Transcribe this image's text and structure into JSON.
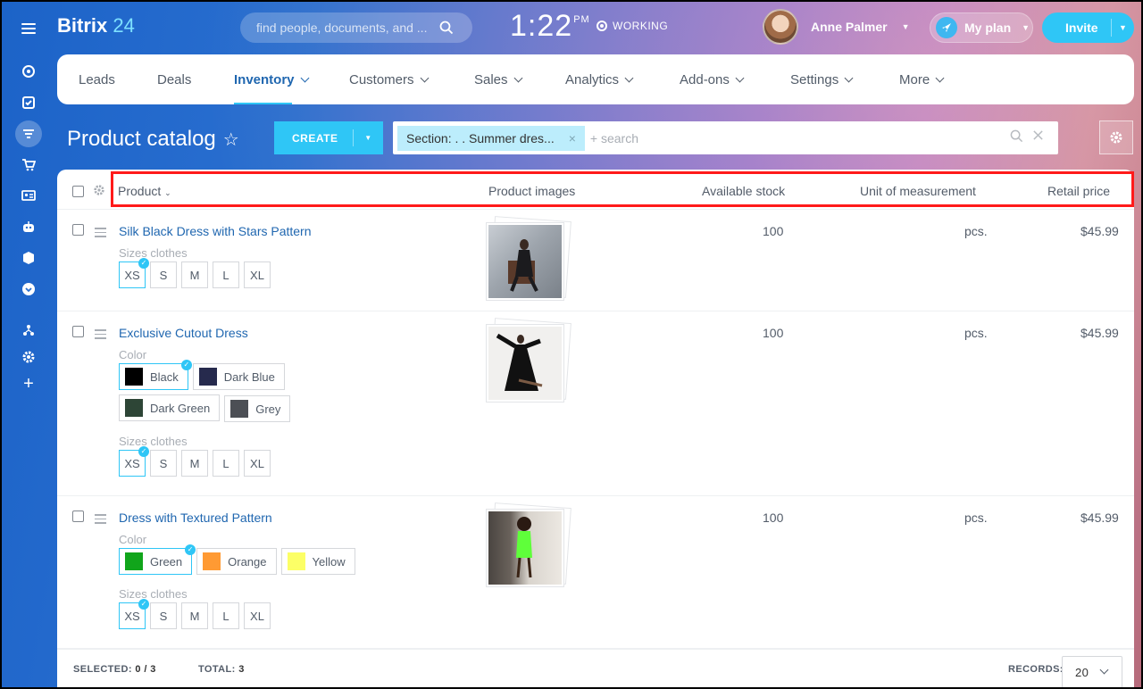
{
  "app": {
    "logo_main": "Bitrix",
    "logo_num": "24"
  },
  "search": {
    "placeholder": "find people, documents, and ..."
  },
  "clock": {
    "time": "1:22",
    "ampm": "PM",
    "status": "WORKING"
  },
  "user": {
    "name": "Anne Palmer"
  },
  "plan": {
    "label": "My plan"
  },
  "invite": {
    "label": "Invite"
  },
  "nav": {
    "items": [
      {
        "label": "Leads"
      },
      {
        "label": "Deals"
      },
      {
        "label": "Inventory"
      },
      {
        "label": "Customers"
      },
      {
        "label": "Sales"
      },
      {
        "label": "Analytics"
      },
      {
        "label": "Add-ons"
      },
      {
        "label": "Settings"
      },
      {
        "label": "More"
      }
    ],
    "active": "Inventory"
  },
  "page": {
    "title": "Product catalog"
  },
  "create": {
    "label": "CREATE"
  },
  "filter": {
    "chip": "Section: . . Summer dres...",
    "chip_close": "×",
    "placeholder": "+ search"
  },
  "table": {
    "headers": [
      "Product",
      "Product images",
      "Available stock",
      "Unit of measurement",
      "Retail price"
    ],
    "rows": [
      {
        "name": "Silk Black Dress with Stars Pattern",
        "size_label": "Sizes clothes",
        "sizes": [
          "XS",
          "S",
          "M",
          "L",
          "XL"
        ],
        "stock": "100",
        "unit": "pcs.",
        "price": "$45.99"
      },
      {
        "name": "Exclusive Cutout Dress",
        "color_label": "Color",
        "colors": [
          {
            "name": "Black",
            "hex": "#000000"
          },
          {
            "name": "Dark Blue",
            "hex": "#262a4d"
          },
          {
            "name": "Dark Green",
            "hex": "#2d4536"
          },
          {
            "name": "Grey",
            "hex": "#4c4f55"
          }
        ],
        "size_label": "Sizes clothes",
        "sizes": [
          "XS",
          "S",
          "M",
          "L",
          "XL"
        ],
        "stock": "100",
        "unit": "pcs.",
        "price": "$45.99"
      },
      {
        "name": "Dress with Textured Pattern",
        "color_label": "Color",
        "colors": [
          {
            "name": "Green",
            "hex": "#11a51b"
          },
          {
            "name": "Orange",
            "hex": "#ff9a33"
          },
          {
            "name": "Yellow",
            "hex": "#fcff66"
          }
        ],
        "size_label": "Sizes clothes",
        "sizes": [
          "XS",
          "S",
          "M",
          "L",
          "XL"
        ],
        "stock": "100",
        "unit": "pcs.",
        "price": "$45.99"
      }
    ]
  },
  "footer": {
    "selected_label": "SELECTED:",
    "selected_value": "0 / 3",
    "total_label": "TOTAL:",
    "total_value": "3",
    "records_label": "RECORDS:",
    "records_value": "20"
  },
  "colors": {
    "accent": "#2fc6f6",
    "link": "#2067b0",
    "highlight": "#ff1a1a"
  }
}
